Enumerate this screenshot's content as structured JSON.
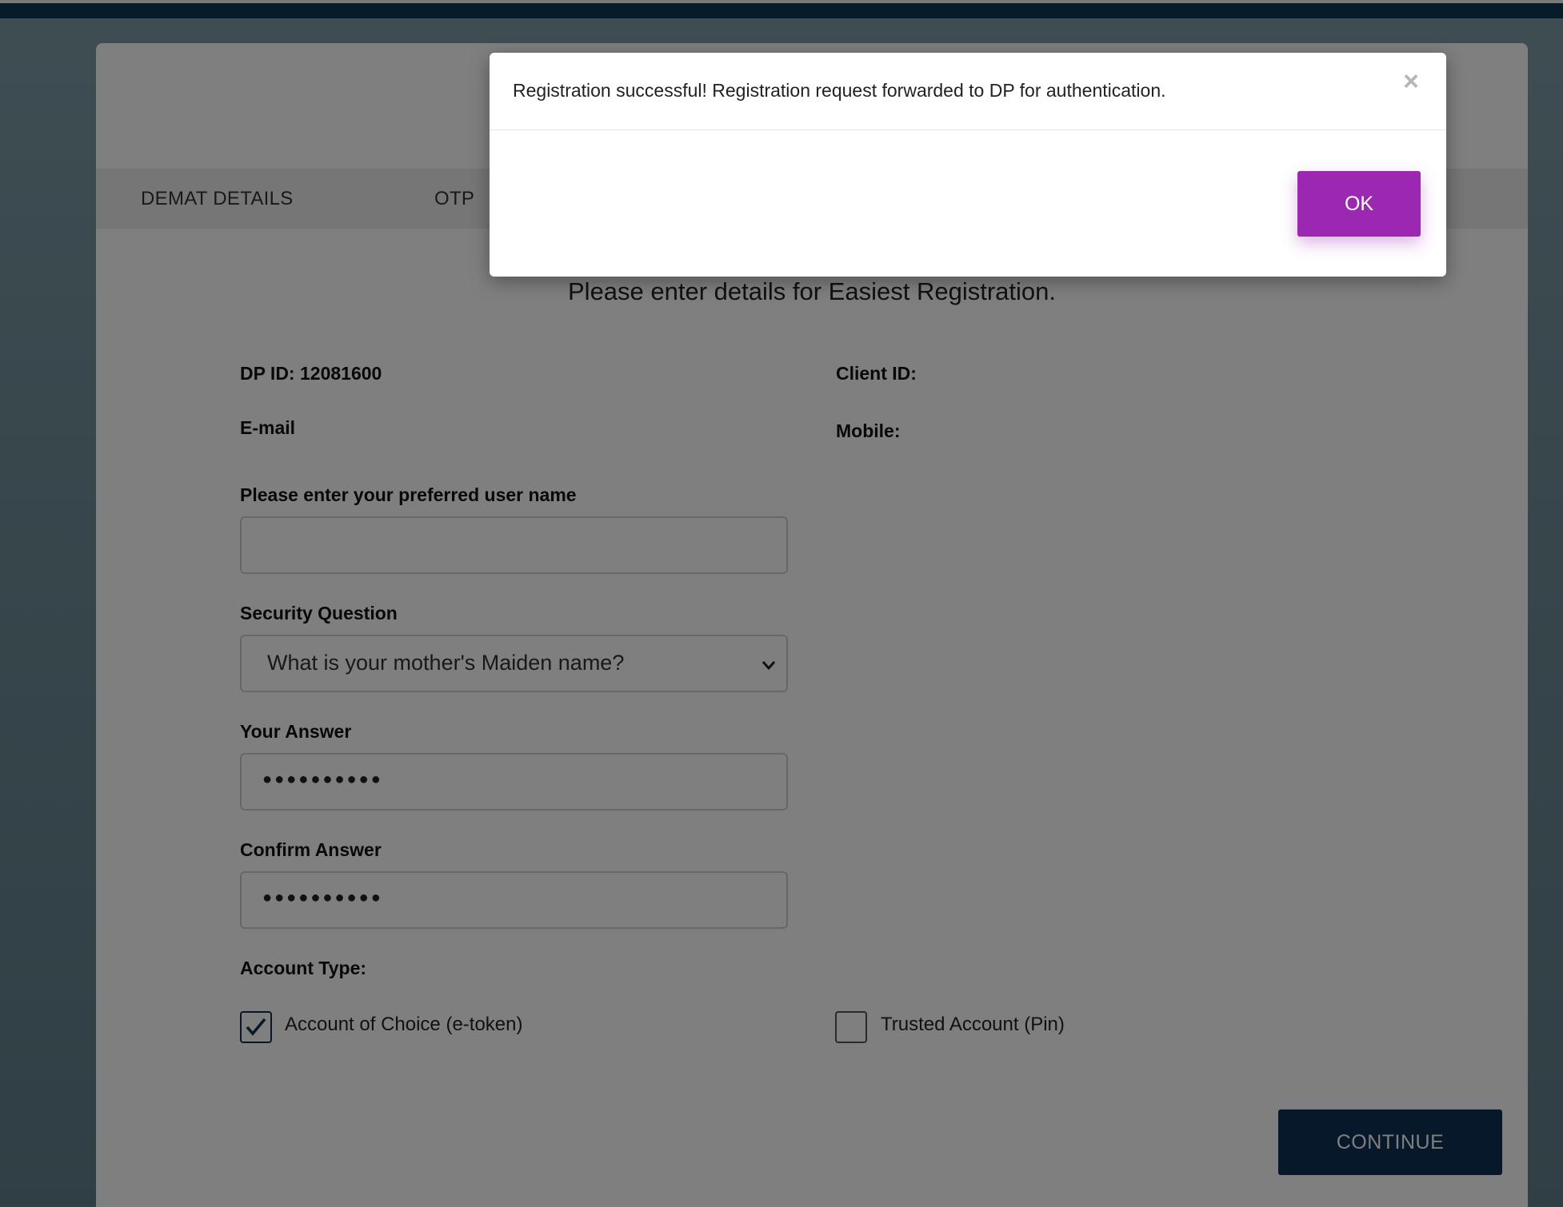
{
  "page": {
    "tabs": [
      {
        "label": "DEMAT DETAILS"
      },
      {
        "label": "OTP"
      }
    ],
    "heading": "Please enter details for Easiest Registration.",
    "dp_id": {
      "label": "DP ID:",
      "value": "12081600"
    },
    "client_id": {
      "label": "Client ID:"
    },
    "email": {
      "label": "E-mail:"
    },
    "mobile": {
      "label": "Mobile:"
    },
    "username": {
      "label": "Please enter your preferred user name"
    },
    "security_question": {
      "label": "Security Question",
      "selected": "What is your mother's Maiden name?"
    },
    "answer": {
      "label": "Your Answer",
      "value": "●●●●●●●●●●"
    },
    "confirm_answer": {
      "label": "Confirm Answer",
      "value": "●●●●●●●●●●"
    },
    "account_type": {
      "label": "Account Type:",
      "options": [
        {
          "label": "Account of Choice (e-token)",
          "checked": true
        },
        {
          "label": "Trusted Account (Pin)",
          "checked": false
        }
      ]
    },
    "continue_label": "CONTINUE"
  },
  "modal": {
    "message": "Registration successful! Registration request forwarded to DP for authentication.",
    "close_glyph": "×",
    "ok_label": "OK"
  },
  "colors": {
    "header_bar": "#0c3853",
    "continue_button": "#0c3055",
    "ok_button": "#9c27b0"
  }
}
